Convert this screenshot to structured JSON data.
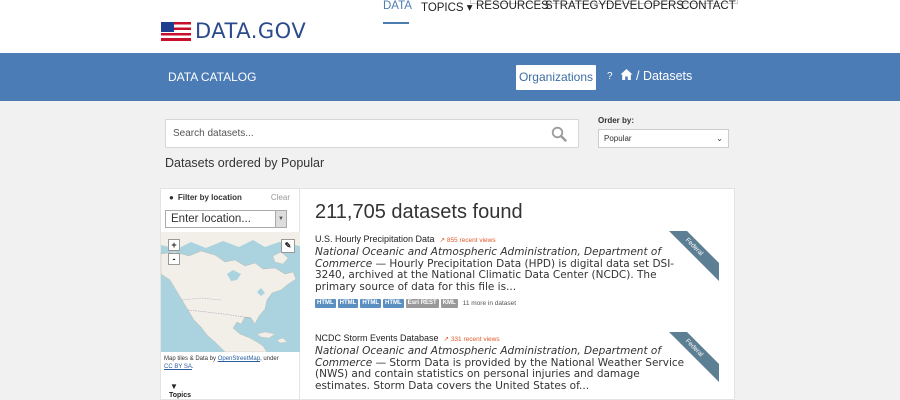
{
  "brand": {
    "name": "DATA.GOV"
  },
  "nav": {
    "items": [
      {
        "label": "DATA",
        "active": true
      },
      {
        "label": "TOPICS ▾",
        "active": false
      },
      {
        "label": "RESOURCES",
        "active": false
      },
      {
        "label": "STRATEGY",
        "active": false
      },
      {
        "label": "DEVELOPERS",
        "active": false
      },
      {
        "label": "CONTACT",
        "active": false
      }
    ]
  },
  "band": {
    "title": "DATA CATALOG",
    "organizations_button": "Organizations",
    "help_glyph": "?",
    "breadcrumb": "/ Datasets"
  },
  "search": {
    "placeholder": "Search datasets...",
    "order_label": "Order by:",
    "order_value": "Popular",
    "ordered_by_text": "Datasets ordered by Popular"
  },
  "sidebar": {
    "filter_title": "Filter by location",
    "clear_label": "Clear",
    "location_placeholder": "Enter location...",
    "zoom_in": "+",
    "zoom_out": "-",
    "map_credit_prefix": "Map tiles & Data by ",
    "map_credit_link1": "OpenStreetMap",
    "map_credit_mid": ", under ",
    "map_credit_link2": "CC BY SA",
    "map_credit_suffix": ".",
    "topics_label": "Topics"
  },
  "results": {
    "count_text": "211,705 datasets found",
    "datasets": [
      {
        "title": "U.S. Hourly Precipitation Data",
        "views": "855 recent views",
        "org": "National Oceanic and Atmospheric Administration, Department of Commerce",
        "desc": " — Hourly Precipitation Data (HPD) is digital data set DSI-3240, archived at the National Climatic Data Center (NCDC). The primary source of data for this file is...",
        "tags": [
          "HTML",
          "HTML",
          "HTML",
          "HTML",
          "Esri REST",
          "KML"
        ],
        "more": "11 more in dataset",
        "ribbon": "Federal"
      },
      {
        "title": "NCDC Storm Events Database",
        "views": "331 recent views",
        "org": "National Oceanic and Atmospheric Administration, Department of Commerce",
        "desc": " — Storm Data is provided by the National Weather Service (NWS) and contain statistics on personal injuries and damage estimates. Storm Data covers the United States of...",
        "tags": [],
        "more": "",
        "ribbon": "Federal"
      }
    ]
  },
  "colors": {
    "band": "#4b7cb5",
    "brand_blue": "#2b4a8c",
    "ribbon": "#5d7f93",
    "tag_blue": "#5b8fc2",
    "tag_grey": "#999999",
    "views_orange": "#e05a2a"
  }
}
